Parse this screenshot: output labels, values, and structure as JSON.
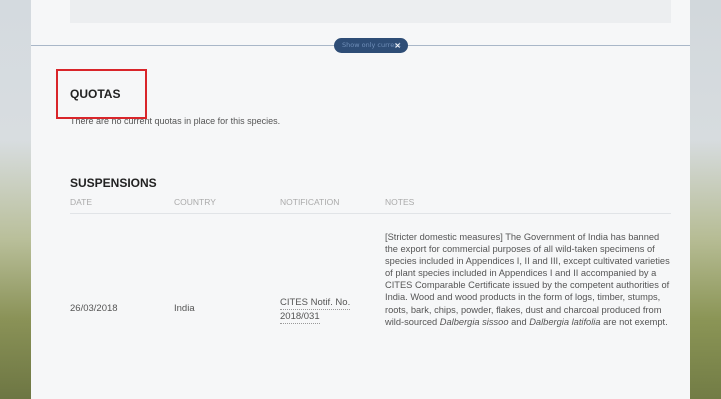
{
  "filter_chip": {
    "label": "Show only current",
    "close": "×"
  },
  "quotas": {
    "title": "QUOTAS",
    "message": "There are no current quotas in place for this species."
  },
  "suspensions": {
    "title": "SUSPENSIONS",
    "columns": [
      "DATE",
      "COUNTRY",
      "NOTIFICATION",
      "NOTES"
    ],
    "rows": [
      {
        "date": "26/03/2018",
        "country": "India",
        "notification_line1": "CITES Notif. No.",
        "notification_line2": "2018/031",
        "notes_text": "[Stricter domestic measures] The Government of India has banned the export for commercial purposes of all wild-taken specimens of species included in Appendices I, II and III, except cultivated varieties of plant species included in Appendices I and II accompanied by a CITES Comparable Certificate issued by the competent authorities of India. Wood and wood products in the form of logs, timber, stumps, roots, bark, chips, powder, flakes, dust and charcoal produced from wild-sourced ",
        "notes_species1": "Dalbergia sissoo",
        "notes_and": " and ",
        "notes_species2": "Dalbergia latifolia",
        "notes_end": " are not exempt."
      }
    ]
  },
  "colors": {
    "accent": "#2e4d76",
    "highlight_box": "#d9252a"
  }
}
